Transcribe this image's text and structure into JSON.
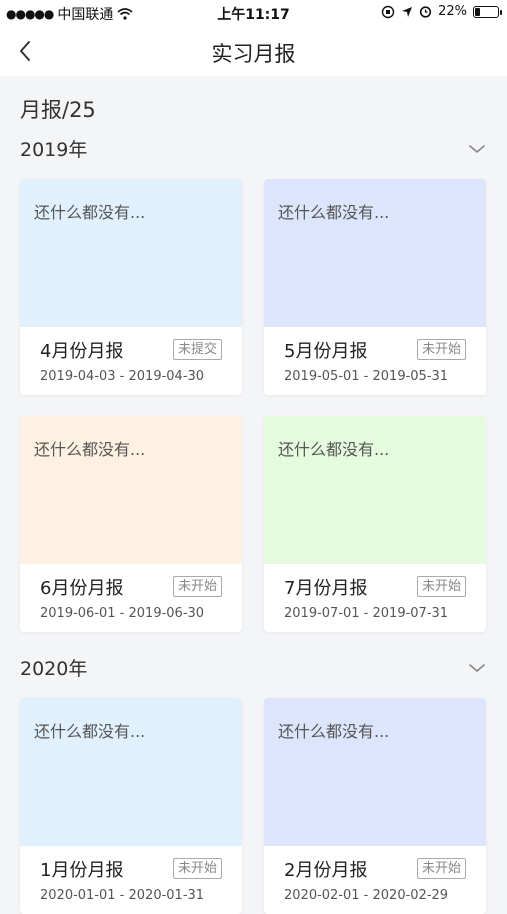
{
  "status_bar": {
    "carrier": "中国联通",
    "time": "上午11:17",
    "battery_percent": "22%",
    "battery_level": 0.22
  },
  "nav": {
    "title": "实习月报",
    "back_icon": "chevron-left-icon"
  },
  "subtitle": "月报/25",
  "colors": {
    "blue": "#e1f0fd",
    "lavender": "#dde5fc",
    "peach": "#fdf1e1",
    "green": "#e5fbdd"
  },
  "years": [
    {
      "label": "2019年",
      "cards": [
        {
          "empty": "还什么都没有...",
          "title": "4月份月报",
          "status": "未提交",
          "range": "2019-04-03 - 2019-04-30",
          "color": "#e1f0fd"
        },
        {
          "empty": "还什么都没有...",
          "title": "5月份月报",
          "status": "未开始",
          "range": "2019-05-01 - 2019-05-31",
          "color": "#dde5fc"
        },
        {
          "empty": "还什么都没有...",
          "title": "6月份月报",
          "status": "未开始",
          "range": "2019-06-01 - 2019-06-30",
          "color": "#fdf1e1"
        },
        {
          "empty": "还什么都没有...",
          "title": "7月份月报",
          "status": "未开始",
          "range": "2019-07-01 - 2019-07-31",
          "color": "#e5fbdd"
        }
      ]
    },
    {
      "label": "2020年",
      "cards": [
        {
          "empty": "还什么都没有...",
          "title": "1月份月报",
          "status": "未开始",
          "range": "2020-01-01 - 2020-01-31",
          "color": "#e1f0fd"
        },
        {
          "empty": "还什么都没有...",
          "title": "2月份月报",
          "status": "未开始",
          "range": "2020-02-01 - 2020-02-29",
          "color": "#dde5fc"
        }
      ]
    }
  ]
}
